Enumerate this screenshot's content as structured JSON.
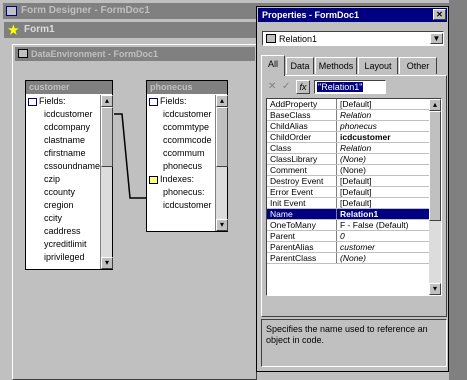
{
  "form_designer": {
    "title": "Form Designer - FormDoc1"
  },
  "form1": {
    "title": "Form1"
  },
  "data_env": {
    "title": "DataEnvironment - FormDoc1"
  },
  "customer": {
    "title": "customer",
    "fields_label": "Fields:",
    "fields": [
      "icdcustomer",
      "cdcompany",
      "clastname",
      "cfirstname",
      "cssoundname",
      "czip",
      "ccounty",
      "cregion",
      "ccity",
      "caddress",
      "ycreditlimit",
      "iprivileged"
    ]
  },
  "phonecus": {
    "title": "phonecus",
    "fields_label": "Fields:",
    "fields": [
      "icdcustomer",
      "ccommtype",
      "ccommcode",
      "ccommum",
      "phonecus"
    ],
    "indexes_label": "Indexes:",
    "indexes": [
      "phonecus:",
      "icdcustomer"
    ]
  },
  "properties": {
    "title": "Properties - FormDoc1",
    "object": "Relation1",
    "tabs": [
      "All",
      "Data",
      "Methods",
      "Layout",
      "Other"
    ],
    "active_tab": "All",
    "edit_value": "\"Relation1\"",
    "rows": [
      {
        "name": "AddProperty",
        "value": "[Default]",
        "italic": false
      },
      {
        "name": "BaseClass",
        "value": "Relation",
        "italic": true
      },
      {
        "name": "ChildAlias",
        "value": "phonecus",
        "italic": true
      },
      {
        "name": "ChildOrder",
        "value": "icdcustomer",
        "italic": false,
        "bold": true
      },
      {
        "name": "Class",
        "value": "Relation",
        "italic": true
      },
      {
        "name": "ClassLibrary",
        "value": "(None)",
        "italic": true
      },
      {
        "name": "Comment",
        "value": "(None)",
        "italic": false
      },
      {
        "name": "Destroy Event",
        "value": "[Default]",
        "italic": false
      },
      {
        "name": "Error Event",
        "value": "[Default]",
        "italic": false
      },
      {
        "name": "Init Event",
        "value": "[Default]",
        "italic": false
      },
      {
        "name": "Name",
        "value": "Relation1",
        "italic": false,
        "bold": true,
        "selected": true
      },
      {
        "name": "OneToMany",
        "value": "F - False (Default)",
        "italic": false
      },
      {
        "name": "Parent",
        "value": "0",
        "italic": true
      },
      {
        "name": "ParentAlias",
        "value": "customer",
        "italic": true
      },
      {
        "name": "ParentClass",
        "value": "(None)",
        "italic": true
      }
    ],
    "description": "Specifies the name used to reference an object in code."
  }
}
